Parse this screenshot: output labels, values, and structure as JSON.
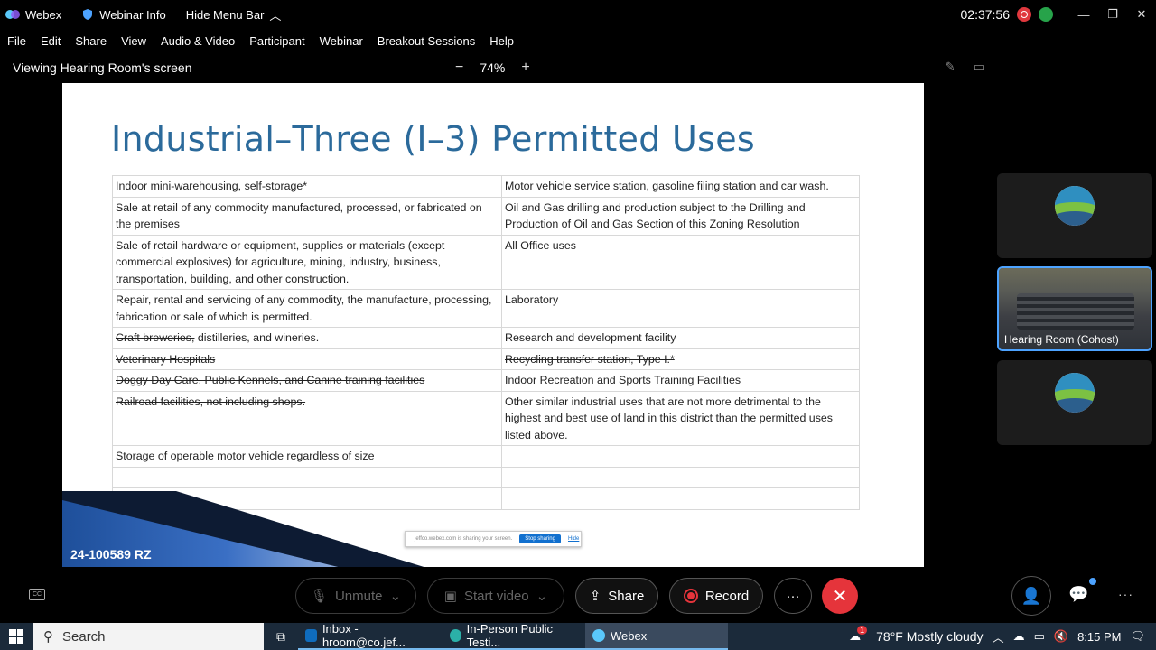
{
  "titlebar": {
    "app_name": "Webex",
    "webinar_info": "Webinar Info",
    "hide_menu": "Hide Menu Bar",
    "timer": "02:37:56"
  },
  "menu": [
    "File",
    "Edit",
    "Share",
    "View",
    "Audio & Video",
    "Participant",
    "Webinar",
    "Breakout Sessions",
    "Help"
  ],
  "viewbar": {
    "viewing": "Viewing Hearing Room's screen",
    "zoom_minus": "−",
    "zoom_level": "74%",
    "zoom_plus": "+"
  },
  "slide": {
    "title": "Industrial–Three (I–3) Permitted Uses",
    "case_number": "24-100589 RZ",
    "share_notice": "jeffco.webex.com is sharing your screen.",
    "stop_sharing": "Stop sharing",
    "hide": "Hide",
    "rows": [
      {
        "left": "Indoor mini-warehousing, self-storage*",
        "right": "Motor vehicle service station, gasoline filing station and car wash."
      },
      {
        "left": "Sale at retail of any commodity manufactured, processed, or fabricated on the premises",
        "right": "Oil and Gas drilling and production subject to the Drilling and Production of Oil and Gas Section of this Zoning Resolution"
      },
      {
        "left": "Sale of retail hardware or equipment, supplies or materials (except commercial explosives) for agriculture, mining, industry, business, transportation, building, and other construction.",
        "right": "All Office uses"
      },
      {
        "left": "Repair, rental and servicing of any commodity, the manufacture, processing, fabrication or sale of which is permitted.",
        "right": "Laboratory"
      },
      {
        "left_strike": "Craft breweries,",
        "left": " distilleries, and wineries.",
        "right": "Research and development facility"
      },
      {
        "left_strike": "Veterinary Hospitals",
        "right_strike": "Recycling transfer station, Type I.*"
      },
      {
        "left_strike": "Doggy Day Care, Public Kennels, and Canine training facilities",
        "right": "Indoor Recreation and Sports Training Facilities"
      },
      {
        "left_strike": "Railroad facilities, not including shops.",
        "right": "Other similar industrial uses that are not more detrimental to the highest and best use of land in this district than the permitted uses listed above."
      },
      {
        "left": "Storage of operable motor vehicle regardless of size",
        "right": ""
      },
      {
        "left": "",
        "right": ""
      },
      {
        "left": "",
        "right": ""
      }
    ]
  },
  "participants": [
    {
      "label": ""
    },
    {
      "label": "Hearing Room (Cohost)"
    },
    {
      "label": ""
    }
  ],
  "controls": {
    "unmute": "Unmute",
    "start_video": "Start video",
    "share": "Share",
    "record": "Record",
    "more": "···",
    "end": "✕"
  },
  "taskbar": {
    "search": "Search",
    "tasks": [
      "Inbox - hroom@co.jef...",
      "In-Person Public Testi...",
      "Webex"
    ],
    "weather": "78°F  Mostly cloudy",
    "time": "8:15 PM",
    "weather_badge": "1"
  },
  "colors": {
    "slide_title": "#2b6a9b",
    "end_button": "#e5343b",
    "active_tile_border": "#4da3ff"
  }
}
